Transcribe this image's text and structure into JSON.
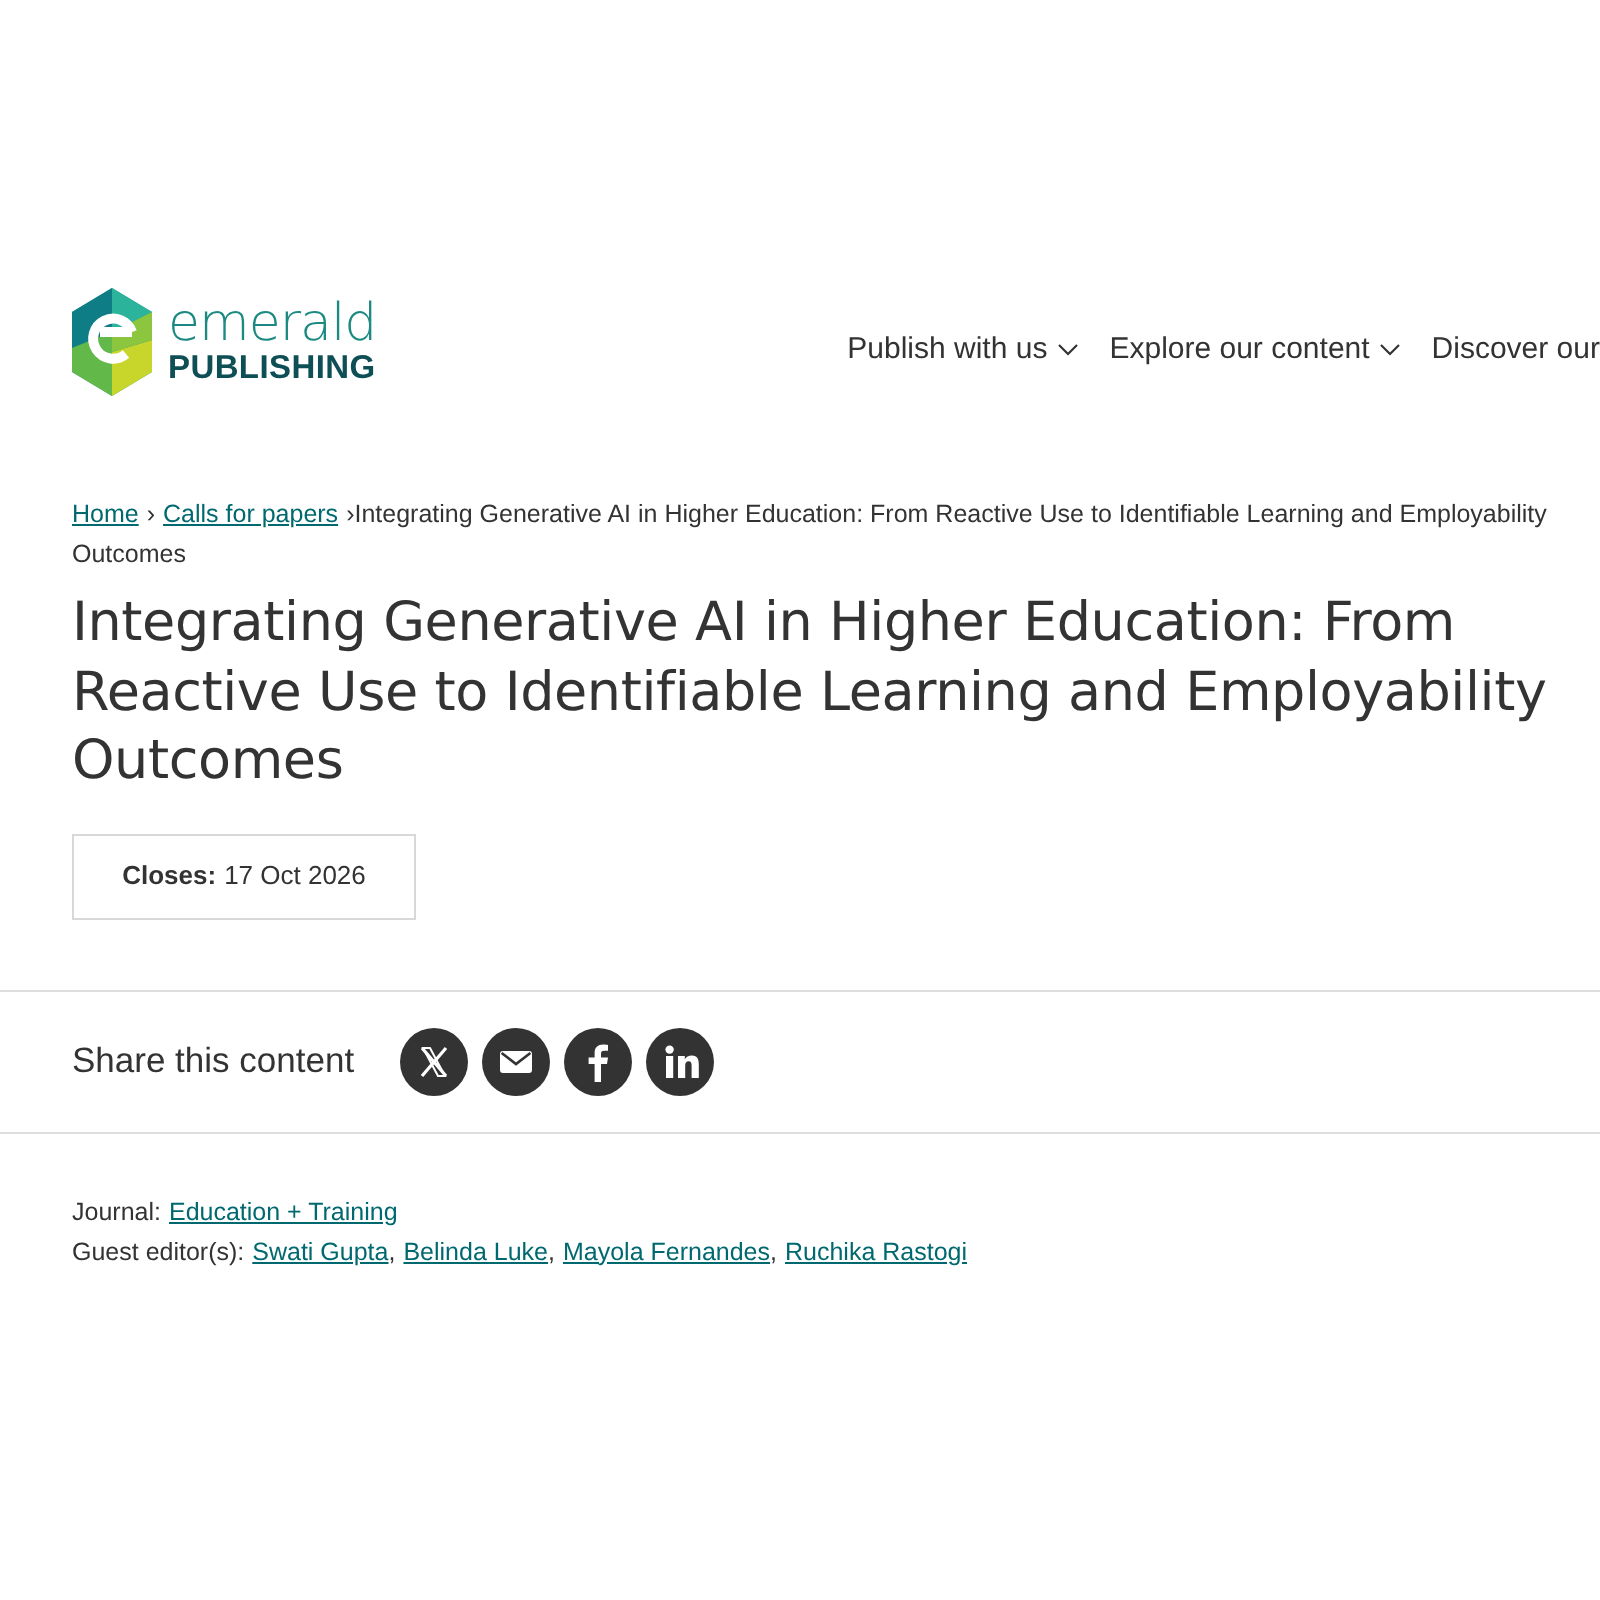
{
  "header": {
    "logo": {
      "wordmark": "emerald",
      "subtitle": "PUBLISHING"
    },
    "nav": [
      {
        "label": "Publish with us",
        "has_menu": true
      },
      {
        "label": "Explore our content",
        "has_menu": true
      },
      {
        "label": "Discover our",
        "has_menu": false
      }
    ]
  },
  "breadcrumb": {
    "separator": "›",
    "items": [
      {
        "label": "Home",
        "kind": "link"
      },
      {
        "label": "Calls for papers",
        "kind": "link"
      },
      {
        "label": "Integrating Generative AI in Higher Education: From Reactive Use to Identifiable Learning and Employability Outcomes",
        "kind": "current"
      }
    ]
  },
  "title": "Integrating Generative AI in Higher Education: From Reactive Use to Identifiable Learning and Employability Outcomes",
  "closes": {
    "label": "Closes:",
    "date": "17 Oct 2026"
  },
  "share": {
    "label": "Share this content",
    "buttons": [
      {
        "kind": "x"
      },
      {
        "kind": "email"
      },
      {
        "kind": "facebook"
      },
      {
        "kind": "linkedin"
      }
    ]
  },
  "details": [
    {
      "label": "Journal:",
      "links": [
        "Education + Training"
      ]
    },
    {
      "label": "Guest editor(s):",
      "separator": ",",
      "links": [
        "Swati Gupta",
        "Belinda Luke",
        "Mayola Fernandes",
        "Ruchika Rastogi"
      ]
    }
  ]
}
